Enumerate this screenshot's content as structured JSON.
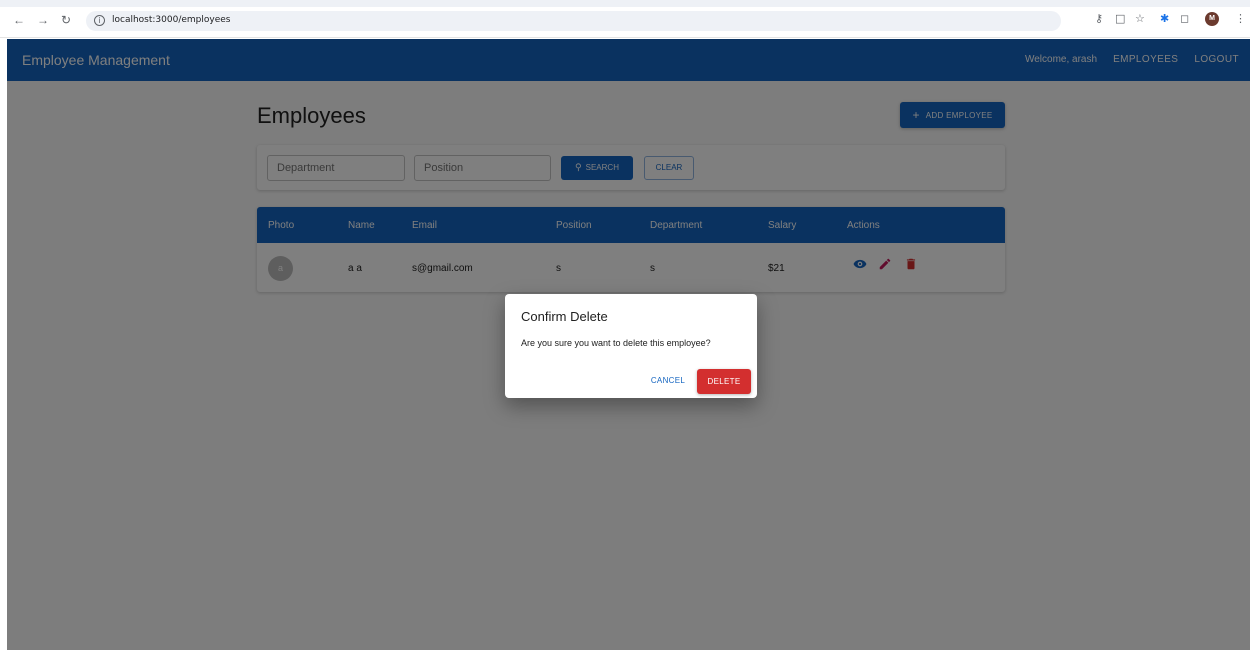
{
  "browser": {
    "url": "localhost:3000/employees",
    "back_icon": "arrow-left-icon",
    "forward_icon": "arrow-right-icon",
    "reload_icon": "reload-icon",
    "profile_initial": "M"
  },
  "appbar": {
    "title": "Employee Management",
    "welcome": "Welcome, arash",
    "employees_link": "EMPLOYEES",
    "logout_link": "LOGOUT",
    "color": "#1565c0"
  },
  "main": {
    "title": "Employees",
    "add_button": "ADD EMPLOYEE"
  },
  "filters": {
    "department_placeholder": "Department",
    "position_placeholder": "Position",
    "search_button": "SEARCH",
    "clear_button": "CLEAR"
  },
  "table": {
    "columns": [
      "Photo",
      "Name",
      "Email",
      "Position",
      "Department",
      "Salary",
      "Actions"
    ],
    "rows": [
      {
        "avatar": "a",
        "name": "a a",
        "email": "s@gmail.com",
        "position": "s",
        "department": "s",
        "salary": "$21"
      }
    ]
  },
  "dialog": {
    "title": "Confirm Delete",
    "message": "Are you sure you want to delete this employee?",
    "cancel": "CANCEL",
    "delete": "DELETE",
    "delete_color": "#d32f2f"
  }
}
